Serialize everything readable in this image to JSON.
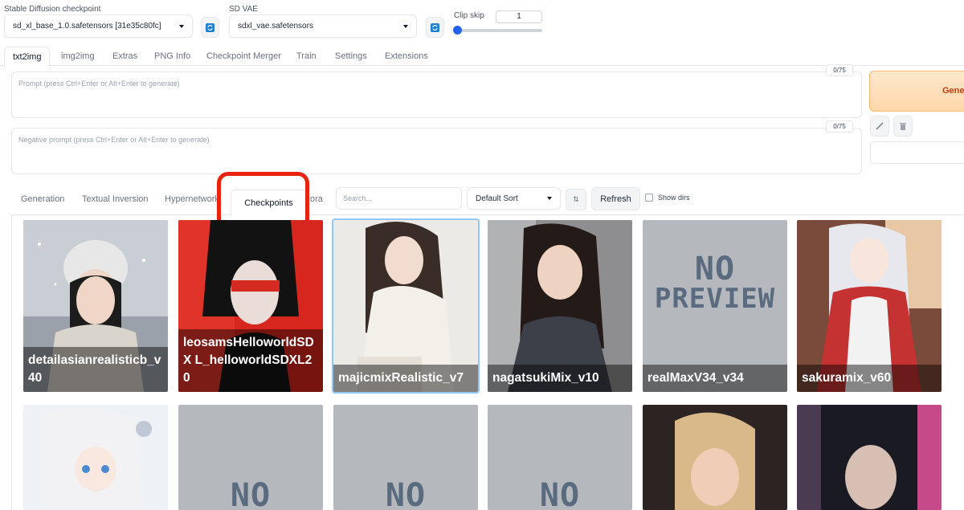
{
  "top": {
    "checkpoint_label": "Stable Diffusion checkpoint",
    "checkpoint_value": "sd_xl_base_1.0.safetensors [31e35c80fc]",
    "vae_label": "SD VAE",
    "vae_value": "sdxl_vae.safetensors",
    "clip_skip_label": "Clip skip",
    "clip_skip_value": "1",
    "clip_skip_level": 0.0
  },
  "tabs": [
    "txt2img",
    "img2img",
    "Extras",
    "PNG Info",
    "Checkpoint Merger",
    "Train",
    "Settings",
    "Extensions"
  ],
  "prompt": {
    "placeholder": "Prompt (press Ctrl+Enter or Alt+Enter to generate)",
    "counter": "0/75"
  },
  "negative_prompt": {
    "placeholder": "Negative prompt (press Ctrl+Enter or Alt+Enter to generate)",
    "counter": "0/75"
  },
  "generate_label": "Gene",
  "subtabs": [
    "Generation",
    "Textual Inversion",
    "Hypernetwork",
    "Checkpoints",
    "ora"
  ],
  "search_placeholder": "Search...",
  "sort_value": "Default Sort",
  "sort_dir": "⇅",
  "refresh_label": "Refresh",
  "show_dirs_label": "Show dirs",
  "cards_row1": [
    {
      "name": "detailasianrealisticb_v40",
      "caption": "detailasianrealisticb_v 40"
    },
    {
      "name": "leosamsHelloworldSDXL_helloworldSDXL20",
      "caption": "leosamsHelloworldSDX L_helloworldSDXL20"
    },
    {
      "name": "majicmixRealistic_v7",
      "caption": "majicmixRealistic_v7"
    },
    {
      "name": "nagatsukiMix_v10",
      "caption": "nagatsukiMix_v10"
    },
    {
      "name": "realMaxV34_v34",
      "caption": "realMaxV34_v34",
      "no_preview": [
        "NO",
        "PREVIEW"
      ]
    },
    {
      "name": "sakuramix_v60",
      "caption": "sakuramix_v60"
    }
  ],
  "no_preview_text": "NO"
}
